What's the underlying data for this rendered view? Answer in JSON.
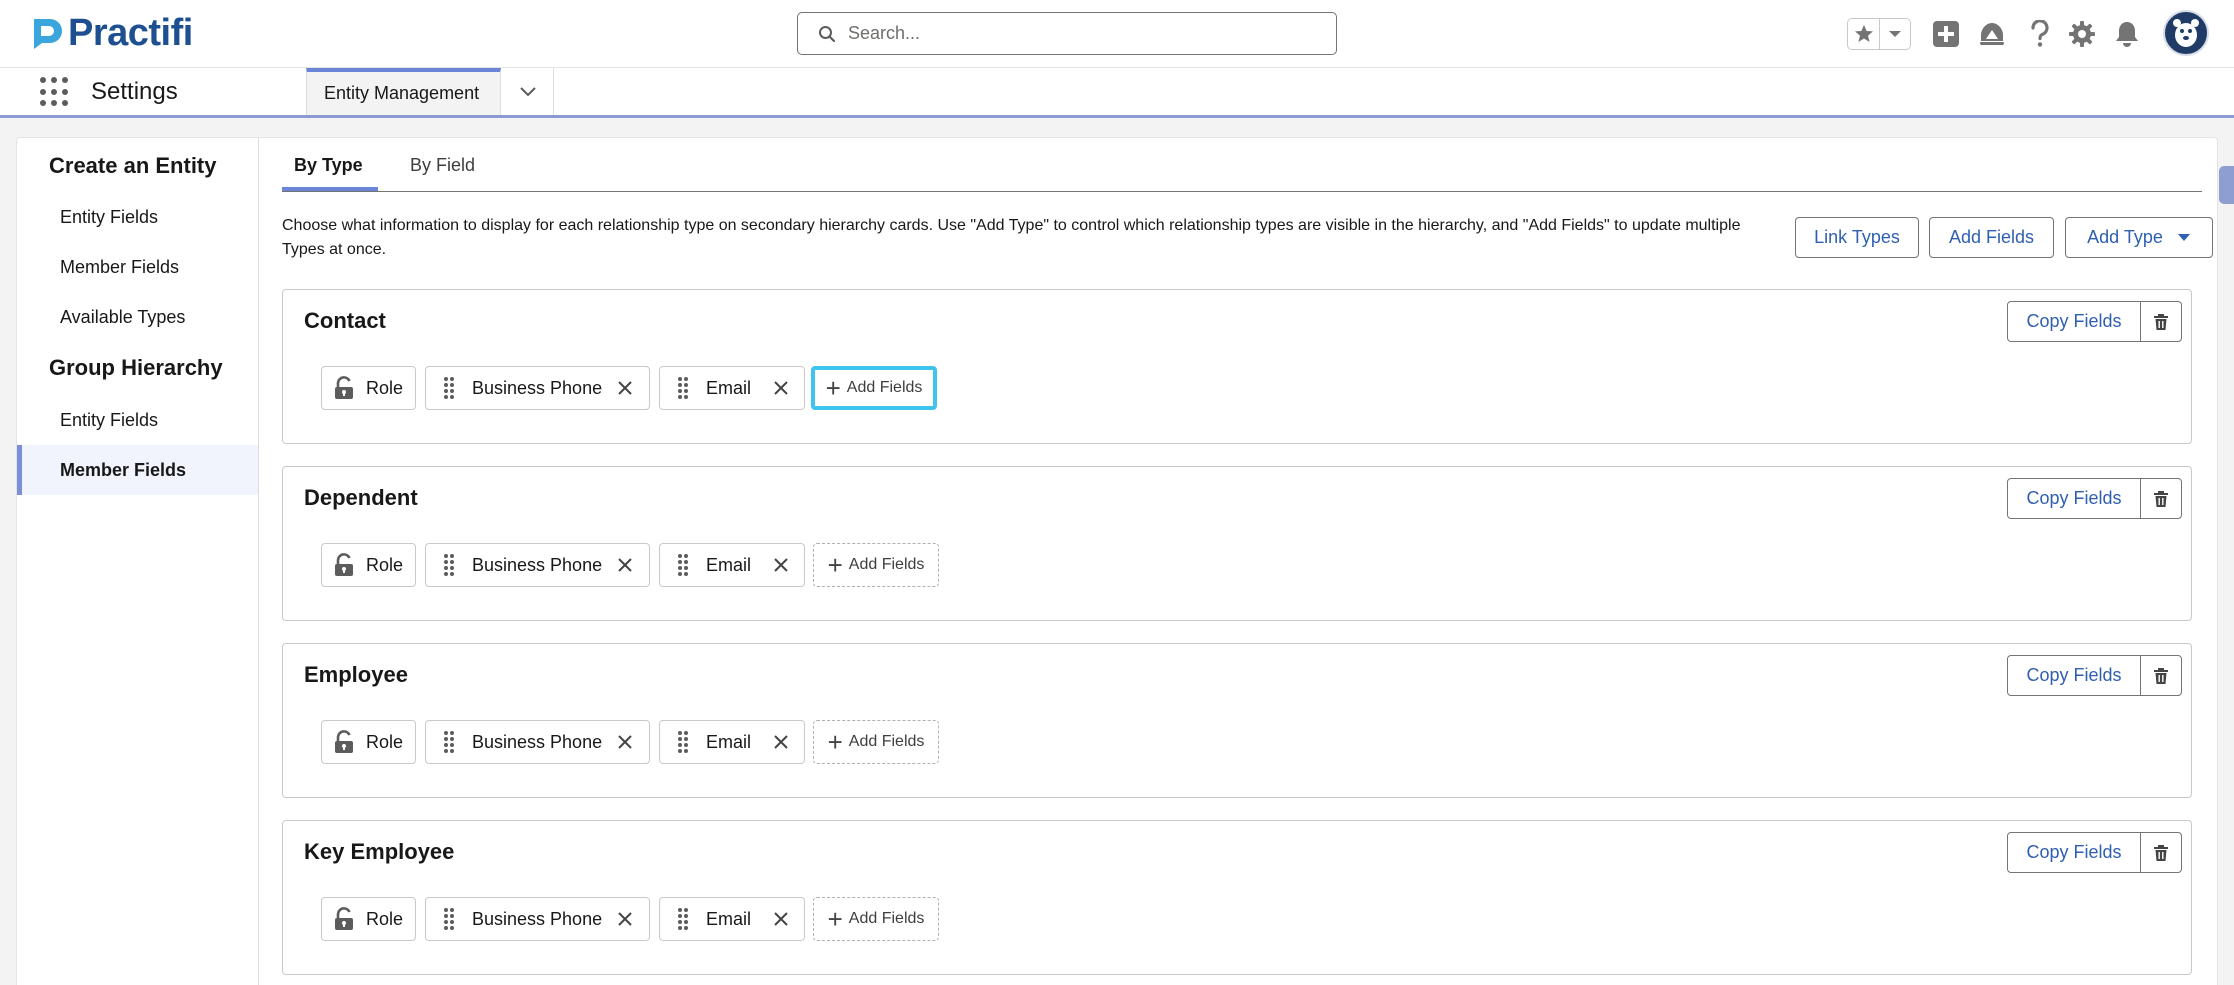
{
  "brand": {
    "name": "Practifi",
    "color": "#1d4f91"
  },
  "header": {
    "search_placeholder": "Search...",
    "icons": [
      "star-icon",
      "chevron-down-icon",
      "add-icon",
      "trailhead-icon",
      "help-icon",
      "gear-icon",
      "bell-icon",
      "avatar"
    ]
  },
  "appnav": {
    "app_name": "Settings",
    "tab_label": "Entity Management"
  },
  "sidebar": {
    "sections": [
      {
        "heading": "Create an Entity",
        "items": [
          "Entity Fields",
          "Member Fields",
          "Available Types"
        ]
      },
      {
        "heading": "Group Hierarchy",
        "items": [
          "Entity Fields",
          "Member Fields"
        ]
      }
    ],
    "active_item": "Member Fields"
  },
  "tabs": [
    "By Type",
    "By Field"
  ],
  "active_tab": "By Type",
  "description": "Choose what information to display for each relationship type on secondary hierarchy cards. Use \"Add Type\" to control which relationship types are visible in the hierarchy, and \"Add Fields\" to update multiple Types at once.",
  "toolbar": {
    "link_types": "Link Types",
    "add_fields": "Add Fields",
    "add_type": "Add Type"
  },
  "card_labels": {
    "copy_fields": "Copy Fields",
    "add_fields": "Add Fields"
  },
  "cards": [
    {
      "title": "Contact",
      "fields": [
        "Role",
        "Business Phone",
        "Email"
      ]
    },
    {
      "title": "Dependent",
      "fields": [
        "Role",
        "Business Phone",
        "Email"
      ]
    },
    {
      "title": "Employee",
      "fields": [
        "Role",
        "Business Phone",
        "Email"
      ]
    },
    {
      "title": "Key Employee",
      "fields": [
        "Role",
        "Business Phone",
        "Email"
      ]
    }
  ],
  "colors": {
    "accent": "#6a85d8",
    "link": "#2e5fb2",
    "focus": "#3fc4ee"
  }
}
